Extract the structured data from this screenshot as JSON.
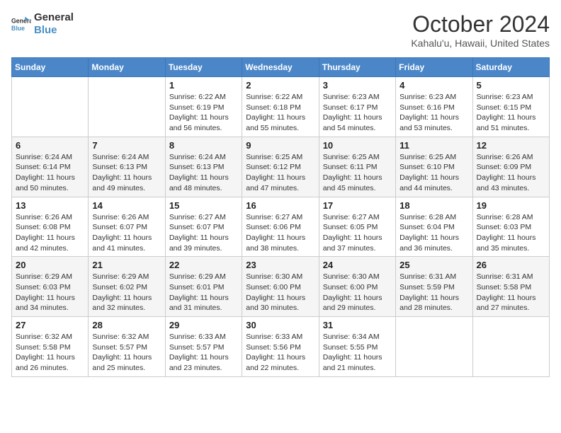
{
  "header": {
    "logo_line1": "General",
    "logo_line2": "Blue",
    "month_title": "October 2024",
    "location": "Kahalu'u, Hawaii, United States"
  },
  "weekdays": [
    "Sunday",
    "Monday",
    "Tuesday",
    "Wednesday",
    "Thursday",
    "Friday",
    "Saturday"
  ],
  "weeks": [
    [
      {
        "day": "",
        "info": ""
      },
      {
        "day": "",
        "info": ""
      },
      {
        "day": "1",
        "info": "Sunrise: 6:22 AM\nSunset: 6:19 PM\nDaylight: 11 hours and 56 minutes."
      },
      {
        "day": "2",
        "info": "Sunrise: 6:22 AM\nSunset: 6:18 PM\nDaylight: 11 hours and 55 minutes."
      },
      {
        "day": "3",
        "info": "Sunrise: 6:23 AM\nSunset: 6:17 PM\nDaylight: 11 hours and 54 minutes."
      },
      {
        "day": "4",
        "info": "Sunrise: 6:23 AM\nSunset: 6:16 PM\nDaylight: 11 hours and 53 minutes."
      },
      {
        "day": "5",
        "info": "Sunrise: 6:23 AM\nSunset: 6:15 PM\nDaylight: 11 hours and 51 minutes."
      }
    ],
    [
      {
        "day": "6",
        "info": "Sunrise: 6:24 AM\nSunset: 6:14 PM\nDaylight: 11 hours and 50 minutes."
      },
      {
        "day": "7",
        "info": "Sunrise: 6:24 AM\nSunset: 6:13 PM\nDaylight: 11 hours and 49 minutes."
      },
      {
        "day": "8",
        "info": "Sunrise: 6:24 AM\nSunset: 6:13 PM\nDaylight: 11 hours and 48 minutes."
      },
      {
        "day": "9",
        "info": "Sunrise: 6:25 AM\nSunset: 6:12 PM\nDaylight: 11 hours and 47 minutes."
      },
      {
        "day": "10",
        "info": "Sunrise: 6:25 AM\nSunset: 6:11 PM\nDaylight: 11 hours and 45 minutes."
      },
      {
        "day": "11",
        "info": "Sunrise: 6:25 AM\nSunset: 6:10 PM\nDaylight: 11 hours and 44 minutes."
      },
      {
        "day": "12",
        "info": "Sunrise: 6:26 AM\nSunset: 6:09 PM\nDaylight: 11 hours and 43 minutes."
      }
    ],
    [
      {
        "day": "13",
        "info": "Sunrise: 6:26 AM\nSunset: 6:08 PM\nDaylight: 11 hours and 42 minutes."
      },
      {
        "day": "14",
        "info": "Sunrise: 6:26 AM\nSunset: 6:07 PM\nDaylight: 11 hours and 41 minutes."
      },
      {
        "day": "15",
        "info": "Sunrise: 6:27 AM\nSunset: 6:07 PM\nDaylight: 11 hours and 39 minutes."
      },
      {
        "day": "16",
        "info": "Sunrise: 6:27 AM\nSunset: 6:06 PM\nDaylight: 11 hours and 38 minutes."
      },
      {
        "day": "17",
        "info": "Sunrise: 6:27 AM\nSunset: 6:05 PM\nDaylight: 11 hours and 37 minutes."
      },
      {
        "day": "18",
        "info": "Sunrise: 6:28 AM\nSunset: 6:04 PM\nDaylight: 11 hours and 36 minutes."
      },
      {
        "day": "19",
        "info": "Sunrise: 6:28 AM\nSunset: 6:03 PM\nDaylight: 11 hours and 35 minutes."
      }
    ],
    [
      {
        "day": "20",
        "info": "Sunrise: 6:29 AM\nSunset: 6:03 PM\nDaylight: 11 hours and 34 minutes."
      },
      {
        "day": "21",
        "info": "Sunrise: 6:29 AM\nSunset: 6:02 PM\nDaylight: 11 hours and 32 minutes."
      },
      {
        "day": "22",
        "info": "Sunrise: 6:29 AM\nSunset: 6:01 PM\nDaylight: 11 hours and 31 minutes."
      },
      {
        "day": "23",
        "info": "Sunrise: 6:30 AM\nSunset: 6:00 PM\nDaylight: 11 hours and 30 minutes."
      },
      {
        "day": "24",
        "info": "Sunrise: 6:30 AM\nSunset: 6:00 PM\nDaylight: 11 hours and 29 minutes."
      },
      {
        "day": "25",
        "info": "Sunrise: 6:31 AM\nSunset: 5:59 PM\nDaylight: 11 hours and 28 minutes."
      },
      {
        "day": "26",
        "info": "Sunrise: 6:31 AM\nSunset: 5:58 PM\nDaylight: 11 hours and 27 minutes."
      }
    ],
    [
      {
        "day": "27",
        "info": "Sunrise: 6:32 AM\nSunset: 5:58 PM\nDaylight: 11 hours and 26 minutes."
      },
      {
        "day": "28",
        "info": "Sunrise: 6:32 AM\nSunset: 5:57 PM\nDaylight: 11 hours and 25 minutes."
      },
      {
        "day": "29",
        "info": "Sunrise: 6:33 AM\nSunset: 5:57 PM\nDaylight: 11 hours and 23 minutes."
      },
      {
        "day": "30",
        "info": "Sunrise: 6:33 AM\nSunset: 5:56 PM\nDaylight: 11 hours and 22 minutes."
      },
      {
        "day": "31",
        "info": "Sunrise: 6:34 AM\nSunset: 5:55 PM\nDaylight: 11 hours and 21 minutes."
      },
      {
        "day": "",
        "info": ""
      },
      {
        "day": "",
        "info": ""
      }
    ]
  ]
}
